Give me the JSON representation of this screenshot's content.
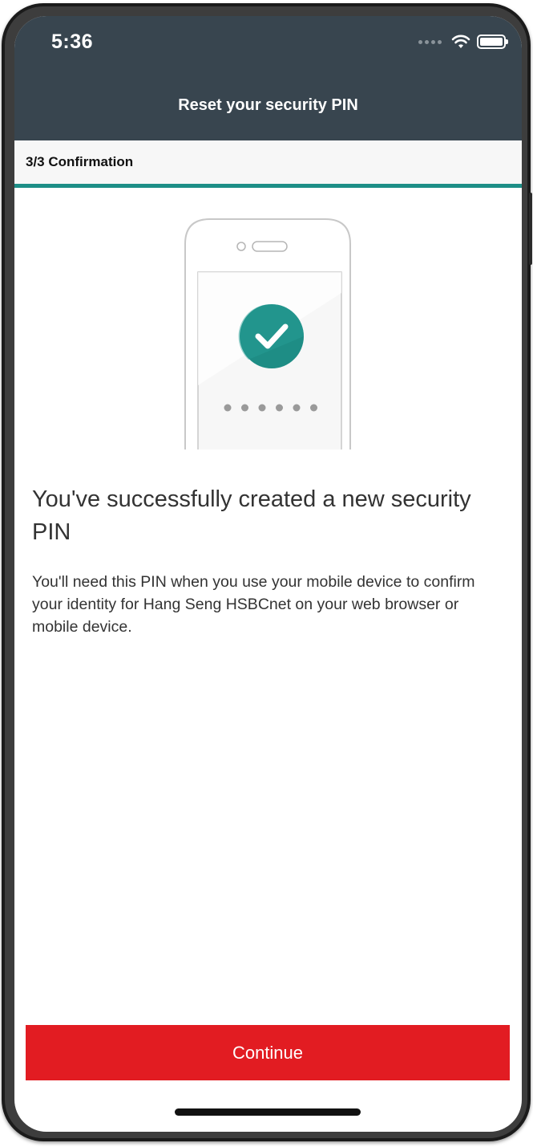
{
  "status_bar": {
    "time": "5:36",
    "icons": [
      "signal-dots-icon",
      "wifi-icon",
      "battery-icon"
    ]
  },
  "header": {
    "title": "Reset your security PIN"
  },
  "step": {
    "label": "3/3 Confirmation"
  },
  "illustration": {
    "icons": [
      "phone-outline-icon",
      "checkmark-circle-icon",
      "pin-dots-icon"
    ],
    "pin_dot_count": 6
  },
  "content": {
    "headline": "You've successfully created a new security PIN",
    "body": "You'll need this PIN when you use your mobile device to confirm your identity for Hang Seng HSBCnet on your web browser or mobile device."
  },
  "actions": {
    "continue_label": "Continue"
  },
  "colors": {
    "header_bg": "#38454f",
    "progress_accent": "#1d8f87",
    "check_green": "#1e8d85",
    "primary_button": "#e21c22"
  }
}
